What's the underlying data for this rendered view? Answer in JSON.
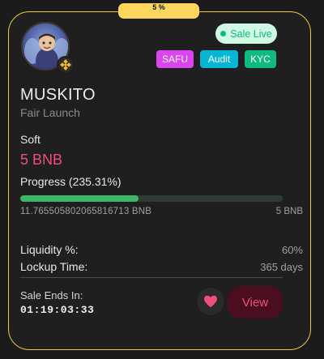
{
  "progress_tab": {
    "label": "5 %"
  },
  "status": {
    "label": "Sale Live",
    "color": "#10b981"
  },
  "tags": [
    {
      "label": "SAFU",
      "color": "#d946ef"
    },
    {
      "label": "Audit",
      "color": "#06b6d4"
    },
    {
      "label": "KYC",
      "color": "#10b981"
    }
  ],
  "project": {
    "name": "MUSKITO",
    "launch_type": "Fair Launch",
    "chain_icon": "bnb-chain-icon"
  },
  "soft_cap": {
    "label": "Soft",
    "value": "5 BNB"
  },
  "progress": {
    "label": "Progress (235.31%)",
    "fill_percent": 45,
    "raised": "11.765505802065816713 BNB",
    "cap": "5 BNB"
  },
  "liquidity": {
    "label": "Liquidity %:",
    "value": "60%"
  },
  "lockup": {
    "label": "Lockup Time:",
    "value": "365 days"
  },
  "sale_ends": {
    "label": "Sale Ends In:",
    "countdown": "01:19:03:33"
  },
  "actions": {
    "favorite_icon": "heart-icon",
    "view_label": "View"
  },
  "colors": {
    "accent": "#ee4f7c",
    "border": "#e9c84a",
    "bar_fill": "#3fb56a"
  }
}
